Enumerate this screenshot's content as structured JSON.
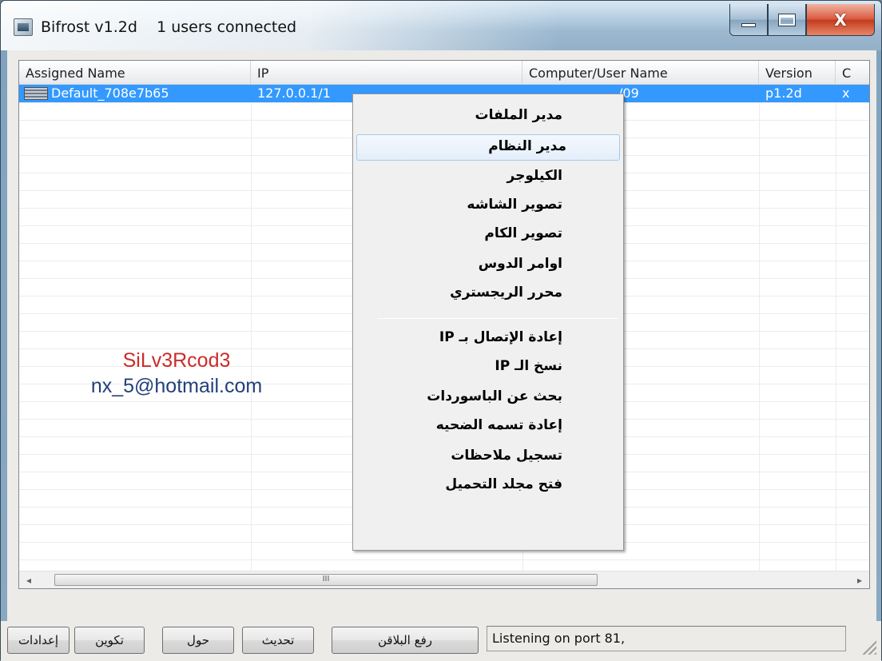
{
  "window": {
    "title": "Bifrost v1.2d    1 users connected",
    "controls": {
      "minimize_icon": "minimize-icon",
      "maximize_icon": "maximize-icon",
      "close_icon": "close-icon",
      "close_glyph": "X"
    }
  },
  "listview": {
    "columns": [
      "Assigned Name",
      "IP",
      "Computer/User Name",
      "Version",
      "C"
    ],
    "rows": [
      {
        "icon": "flag-icon",
        "assigned_name": "Default_708e7b65",
        "ip": "127.0.0.1/1",
        "computer_user": "/09",
        "version": "p1.2d",
        "c": "x"
      }
    ]
  },
  "watermark": {
    "name": "SiLv3Rcod3",
    "email": "nx_5@hotmail.com"
  },
  "context_menu": {
    "items": [
      {
        "label": "مدير الملفات"
      },
      {
        "label": "مدير النظام",
        "highlighted": true
      },
      {
        "label": "الكيلوجر"
      },
      {
        "label": "تصوير الشاشه"
      },
      {
        "label": "تصوير الكام"
      },
      {
        "label": "اوامر الدوس"
      },
      {
        "label": "محرر الريجستري"
      },
      {
        "label": "إعادة الإتصال بـ IP"
      },
      {
        "label": "نسخ الـ IP"
      },
      {
        "label": "بحث عن الباسوردات"
      },
      {
        "label": "إعادة تسمه الضحيه"
      },
      {
        "label": "تسجيل ملاحظات"
      },
      {
        "label": "فتح مجلد التحميل"
      }
    ]
  },
  "scrollbar": {
    "thumb_grip": "III",
    "left_arrow": "◂",
    "right_arrow": "▸"
  },
  "footer": {
    "buttons": {
      "settings": "إعدادات",
      "build": "تكوين",
      "about": "حول",
      "refresh": "تحديث",
      "upload_plugins": "رفع البلاقن"
    },
    "status": "Listening on port 81,"
  }
}
